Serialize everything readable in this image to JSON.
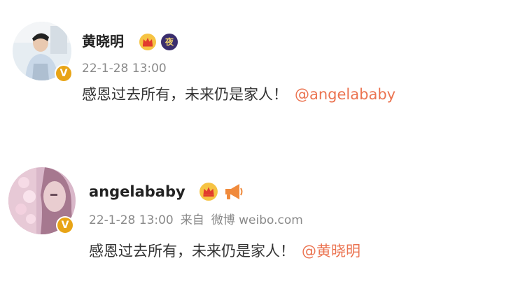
{
  "posts": [
    {
      "author": "黄晓明",
      "time": "22-1-28 13:00",
      "text": "感恩过去所有，未来仍是家人！",
      "mention": "@angelababy",
      "badge_glyph": "夜",
      "icons": [
        "crown-badge-icon",
        "night-badge-icon",
        "verified-badge-icon"
      ]
    },
    {
      "author": "angelababy",
      "time": "22-1-28 13:00",
      "source_prefix": "来自",
      "source": "微博 weibo.com",
      "text": "感恩过去所有，未来仍是家人！",
      "mention": "@黄晓明",
      "icons": [
        "crown-badge-icon",
        "megaphone-icon",
        "verified-badge-icon"
      ]
    }
  ],
  "colors": {
    "mention": "#eb7350",
    "verified": "#e8a416",
    "crown": "#f5a623",
    "name": "#222222",
    "meta": "#8a8a8a"
  }
}
